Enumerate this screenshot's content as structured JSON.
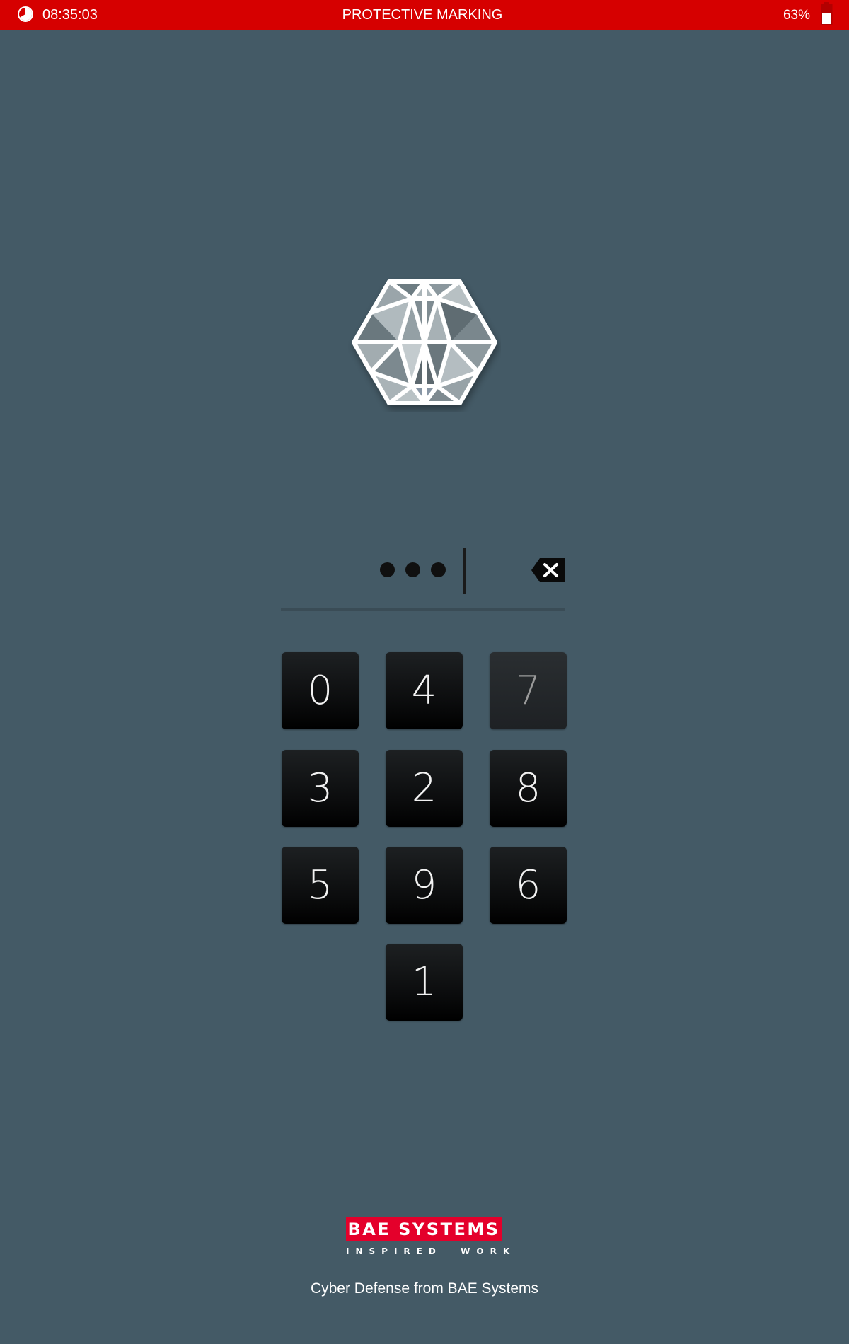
{
  "status_bar": {
    "time": "08:35:03",
    "title": "PROTECTIVE MARKING",
    "battery_percent": "63%",
    "background_color": "#d60000",
    "clock_icon": "clock-icon",
    "battery_icon": "battery-icon"
  },
  "logo": {
    "icon": "hexagon-lattice-logo-icon"
  },
  "pin_entry": {
    "entered_digit_count": 3,
    "masked_value": "•••",
    "backspace_icon": "backspace-icon"
  },
  "keypad": {
    "keys": [
      {
        "label": "0",
        "state": "normal"
      },
      {
        "label": "4",
        "state": "normal"
      },
      {
        "label": "7",
        "state": "pressed"
      },
      {
        "label": "3",
        "state": "normal"
      },
      {
        "label": "2",
        "state": "normal"
      },
      {
        "label": "8",
        "state": "normal"
      },
      {
        "label": "5",
        "state": "normal"
      },
      {
        "label": "9",
        "state": "normal"
      },
      {
        "label": "6",
        "state": "normal"
      },
      {
        "label": "1",
        "state": "normal"
      }
    ]
  },
  "footer": {
    "brand_name": "BAE SYSTEMS",
    "brand_tagline": "INSPIRED  WORK",
    "brand_color": "#e4002b",
    "caption": "Cyber Defense from BAE Systems"
  },
  "background_color": "#445a66"
}
